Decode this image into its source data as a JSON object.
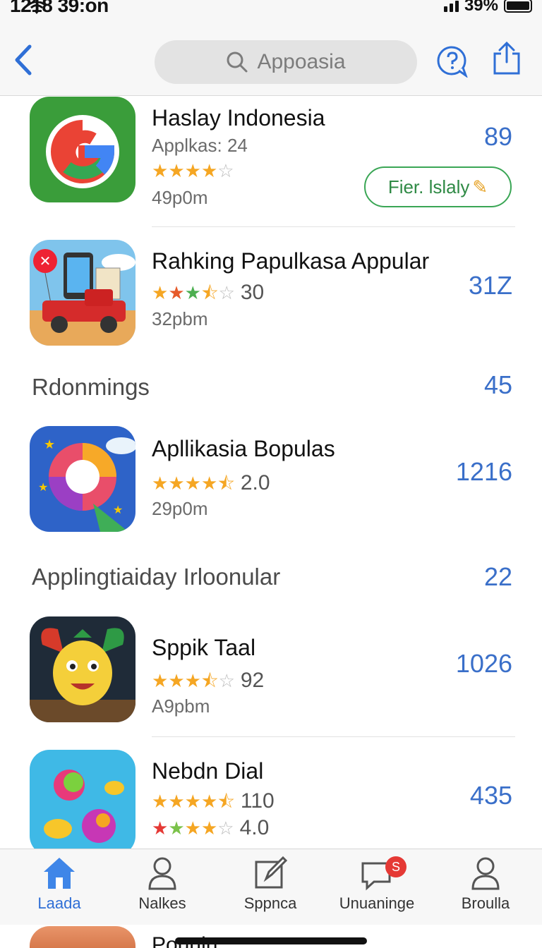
{
  "status_bar": {
    "time": "1218 39:on",
    "battery": "39%"
  },
  "nav": {
    "search_text": "Appoasia"
  },
  "apps": [
    {
      "name": "Haslay Indonesia",
      "subtitle": "Applkas: 24",
      "size": "49p0m",
      "count": "89",
      "button_label": "Fier. lslaly",
      "stars": 4
    },
    {
      "name": "Rahking Papulkasa Appular",
      "rating": "30",
      "size": "32pbm",
      "count": "31Z",
      "stars": 2.5
    },
    {
      "name": "Apllikasia Bopulas",
      "rating": "2.0",
      "size": "29p0m",
      "count": "1216",
      "stars": 4.5
    },
    {
      "name": "Sppik Taal",
      "rating": "92",
      "size": "A9pbm",
      "count": "1026",
      "stars": 3.5
    },
    {
      "name": "Nebdn Dial",
      "rating": "110",
      "rating2": "4.0",
      "count": "435",
      "stars": 4.5,
      "stars2": 4
    }
  ],
  "sections": [
    {
      "title": "Rdonmings",
      "count": "45"
    },
    {
      "title": "Applingtiaiday Irloonular",
      "count": "22"
    }
  ],
  "tabs": [
    {
      "label": "Laada",
      "icon": "home-icon",
      "active": true
    },
    {
      "label": "Nalkes",
      "icon": "person-icon"
    },
    {
      "label": "Sppnca",
      "icon": "edit-icon"
    },
    {
      "label": "Unuaninge",
      "icon": "message-icon",
      "badge": "S"
    },
    {
      "label": "Broulla",
      "icon": "profile-icon"
    }
  ],
  "peek": {
    "text": "Pouuin"
  },
  "colors": {
    "accent": "#3a6fc9",
    "star": "#f5a623",
    "green": "#3aa655",
    "badge": "#e53935"
  }
}
